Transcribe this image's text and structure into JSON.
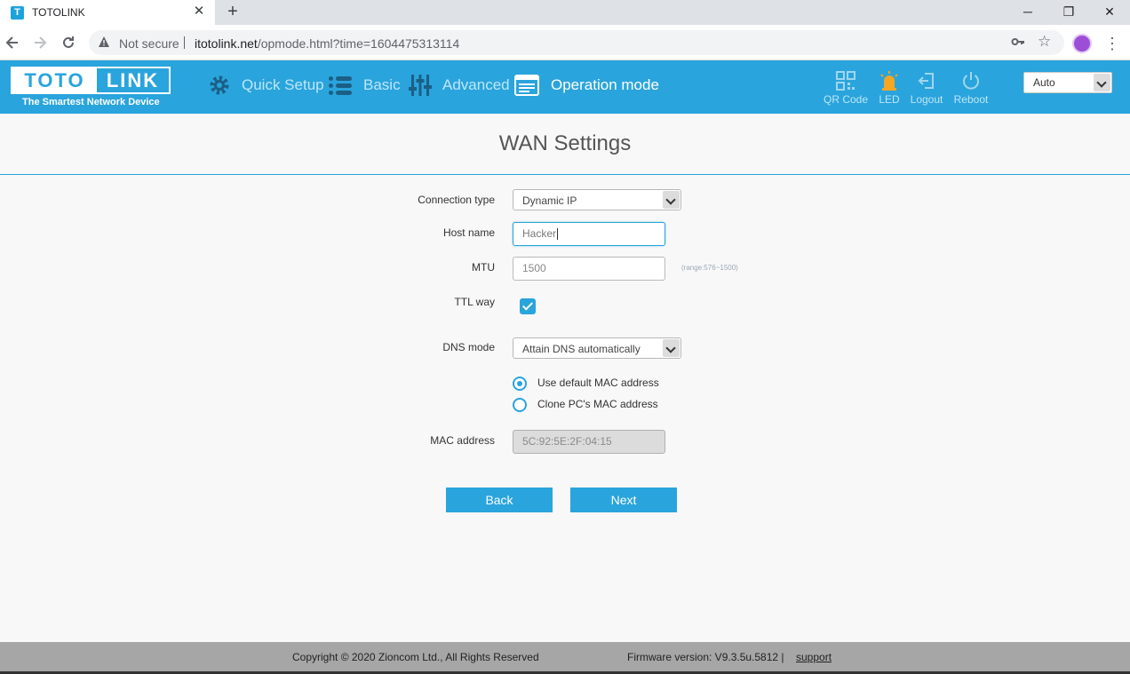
{
  "browser": {
    "tab_title": "TOTOLINK",
    "tab_favicon": "T",
    "close_glyph": "✕",
    "new_tab_glyph": "+",
    "window_minimize": "─",
    "window_restore": "❐",
    "window_close": "✕",
    "security_label": "Not secure",
    "url_host": "itotolink.net",
    "url_path": "/opmode.html?time=1604475313114"
  },
  "header": {
    "logo_left": "TOTO",
    "logo_right": "LINK",
    "tagline": "The Smartest Network Device",
    "nav": [
      {
        "label": "Quick Setup",
        "icon": "gear-icon"
      },
      {
        "label": "Basic",
        "icon": "list-icon"
      },
      {
        "label": "Advanced",
        "icon": "sliders-icon"
      },
      {
        "label": "Operation mode",
        "icon": "operation-mode-icon",
        "active": true
      }
    ],
    "tools": [
      {
        "label": "QR Code",
        "icon": "qr-code-icon"
      },
      {
        "label": "LED",
        "icon": "led-icon"
      },
      {
        "label": "Logout",
        "icon": "logout-icon"
      },
      {
        "label": "Reboot",
        "icon": "power-icon"
      }
    ],
    "language_value": "Auto"
  },
  "form": {
    "title": "WAN Settings",
    "connection_type_label": "Connection type",
    "connection_type_value": "Dynamic IP",
    "host_name_label": "Host name",
    "host_name_value": "Hacker",
    "mtu_label": "MTU",
    "mtu_value": "1500",
    "mtu_hint": "(range:576~1500)",
    "ttl_label": "TTL way",
    "ttl_checked": true,
    "dns_mode_label": "DNS mode",
    "dns_mode_value": "Attain DNS automatically",
    "mac_option_default": "Use default MAC address",
    "mac_option_clone": "Clone PC's MAC address",
    "mac_address_label": "MAC address",
    "mac_address_value": "5C:92:5E:2F:04:15",
    "back_label": "Back",
    "next_label": "Next"
  },
  "footer": {
    "copyright": "Copyright © 2020 Zioncom Ltd., All Rights Reserved",
    "firmware": "Firmware version: V9.3.5u.5812  |",
    "support": "support"
  },
  "colors": {
    "brand_blue": "#2aa4dc",
    "led_orange": "#f5a623",
    "footer_gray": "#a6a6a6"
  }
}
